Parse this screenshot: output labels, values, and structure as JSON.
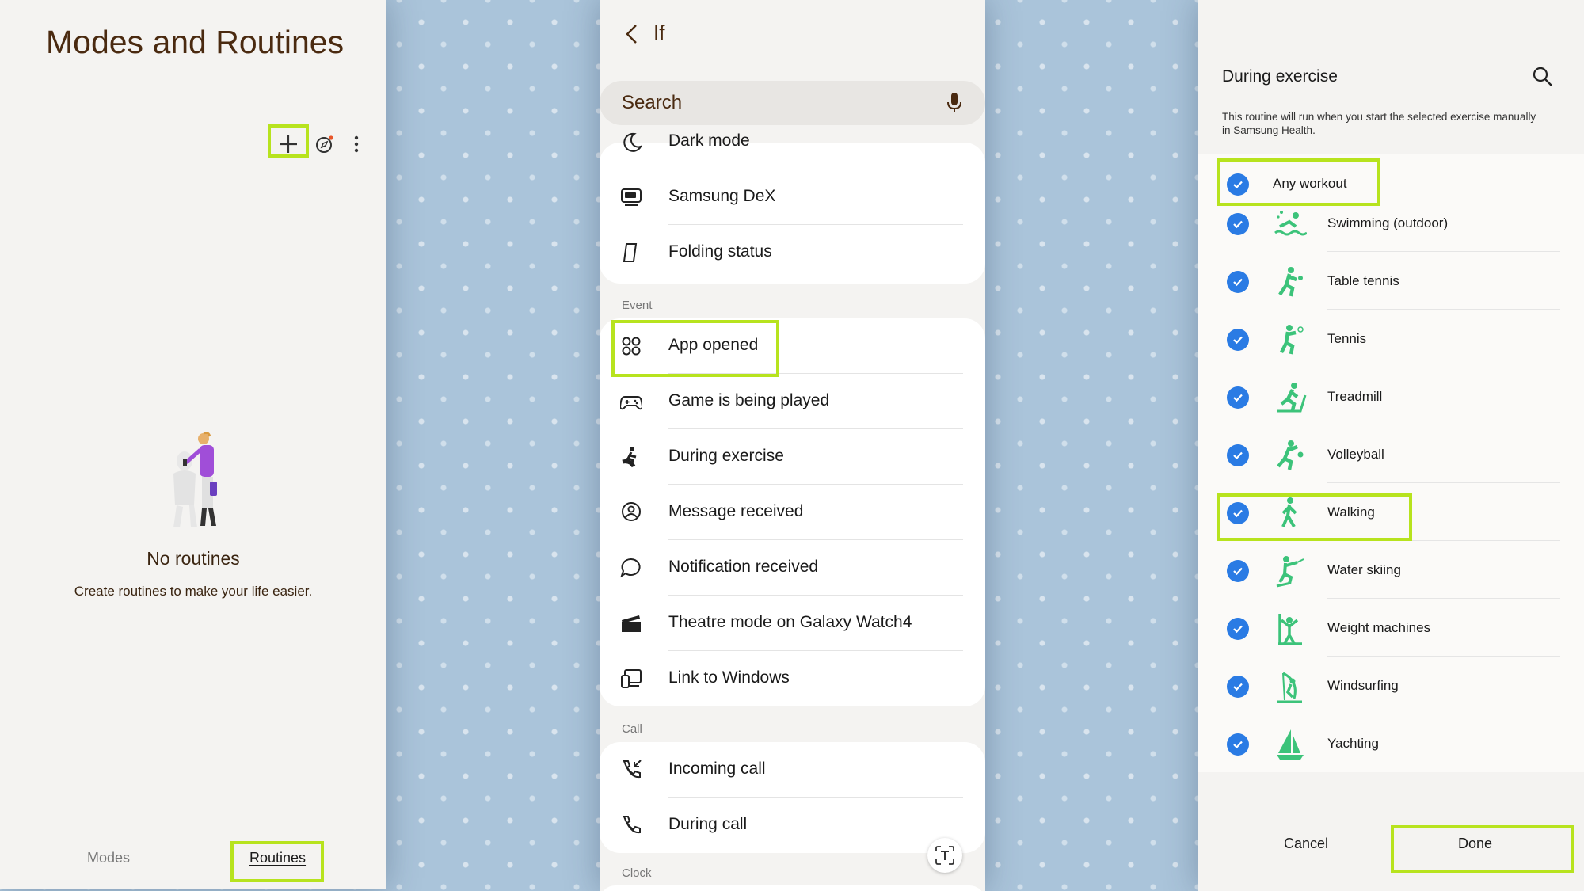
{
  "screen1": {
    "title": "Modes and Routines",
    "empty_title": "No routines",
    "empty_subtitle": "Create routines to make your life easier.",
    "nav_modes": "Modes",
    "nav_routines": "Routines"
  },
  "screen2": {
    "title": "If",
    "search_placeholder": "Search",
    "top_items": [
      "Dark mode",
      "Samsung DeX",
      "Folding status"
    ],
    "event_header": "Event",
    "event_items": [
      "App opened",
      "Game is being played",
      "During exercise",
      "Message received",
      "Notification received",
      "Theatre mode on Galaxy Watch4",
      "Link to Windows"
    ],
    "call_header": "Call",
    "call_items": [
      "Incoming call",
      "During call"
    ],
    "clock_header": "Clock"
  },
  "screen3": {
    "title": "During exercise",
    "description": "This routine will run when you start the selected exercise manually in Samsung Health.",
    "any_workout": "Any workout",
    "exercises": [
      "Swimming (outdoor)",
      "Table tennis",
      "Tennis",
      "Treadmill",
      "Volleyball",
      "Walking",
      "Water skiing",
      "Weight machines",
      "Windsurfing",
      "Yachting"
    ],
    "cancel_label": "Cancel",
    "done_label": "Done"
  },
  "colors": {
    "highlight": "#b7e31e",
    "check_blue": "#2a7be4",
    "exercise_green": "#3cc37a",
    "title_brown": "#4a2a10"
  }
}
